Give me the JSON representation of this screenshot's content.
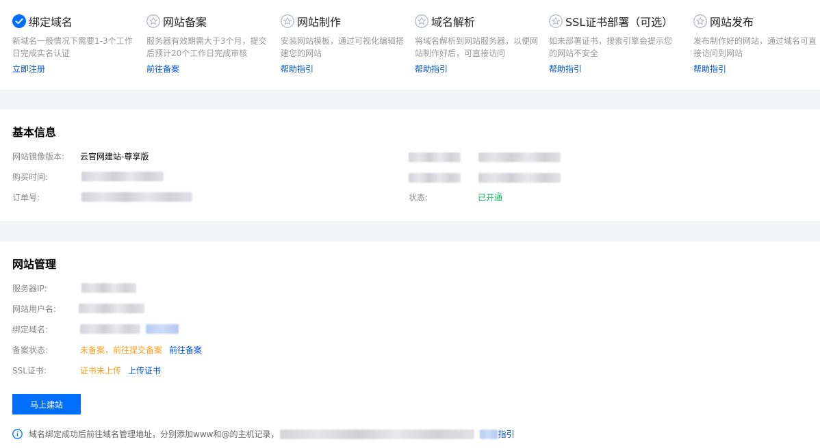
{
  "steps": [
    {
      "title": "绑定域名",
      "desc": "新域名一般情况下需要1-3个工作日完成实名认证",
      "link": "立即注册",
      "status": "done"
    },
    {
      "title": "网站备案",
      "desc": "服务器有效期需大于3个月，提交后预计20个工作日完成审核",
      "link": "前往备案",
      "status": "todo"
    },
    {
      "title": "网站制作",
      "desc": "安装网站模板，通过可视化编辑搭建您的网站",
      "link": "帮助指引",
      "status": "todo"
    },
    {
      "title": "域名解析",
      "desc": "将域名解析到网站服务器，以便网站制作好后，可直接访问",
      "link": "帮助指引",
      "status": "todo"
    },
    {
      "title": "SSL证书部署（可选）",
      "desc": "如未部署证书，搜索引擎会提示您的网站不安全",
      "link": "帮助指引",
      "status": "todo"
    },
    {
      "title": "网站发布",
      "desc": "发布制作好的网站，通过域名可直接访问到网站",
      "link": "帮助指引",
      "status": "todo"
    }
  ],
  "basic": {
    "title": "基本信息",
    "image_version_label": "网站镜像版本:",
    "image_version_value": "云官网建站-尊享版",
    "purchase_time_label": "购买时间:",
    "order_no_label": "订单号:",
    "status_label": "状态:",
    "status_value": "已开通"
  },
  "manage": {
    "title": "网站管理",
    "server_ip_label": "服务器IP:",
    "username_label": "网站用户名:",
    "domain_label": "绑定域名:",
    "icp_label": "备案状态:",
    "icp_status": "未备案，前往提交备案",
    "icp_link": "前往备案",
    "ssl_label": "SSL证书:",
    "ssl_status": "证书未上传",
    "ssl_link": "上传证书",
    "build_button": "马上建站",
    "tip_text": "域名绑定成功后前往域名管理地址，分别添加www和@的主机记录，",
    "tip_link_tail": "指引"
  },
  "colors": {
    "primary": "#006eff",
    "link": "#0052d9",
    "success": "#0abf5b",
    "warning": "#ff9c19"
  }
}
